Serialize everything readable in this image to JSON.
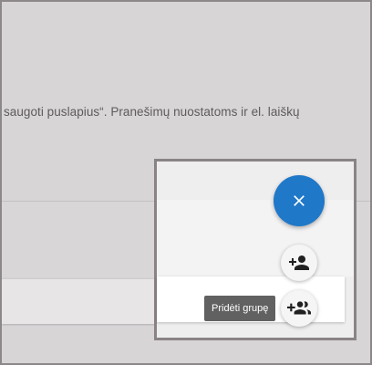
{
  "page": {
    "body_text": "saugoti puslapius“. Pranešimų nuostatoms ir el. laiškų"
  },
  "fab": {
    "main_icon": "close-icon",
    "actions": [
      {
        "icon": "person-add-icon"
      },
      {
        "icon": "group-add-icon",
        "tooltip": "Pridėti grupę"
      }
    ]
  },
  "colors": {
    "fab_main": "#1f78c8",
    "tooltip_bg": "#616161",
    "highlight_border": "#8a8385"
  }
}
